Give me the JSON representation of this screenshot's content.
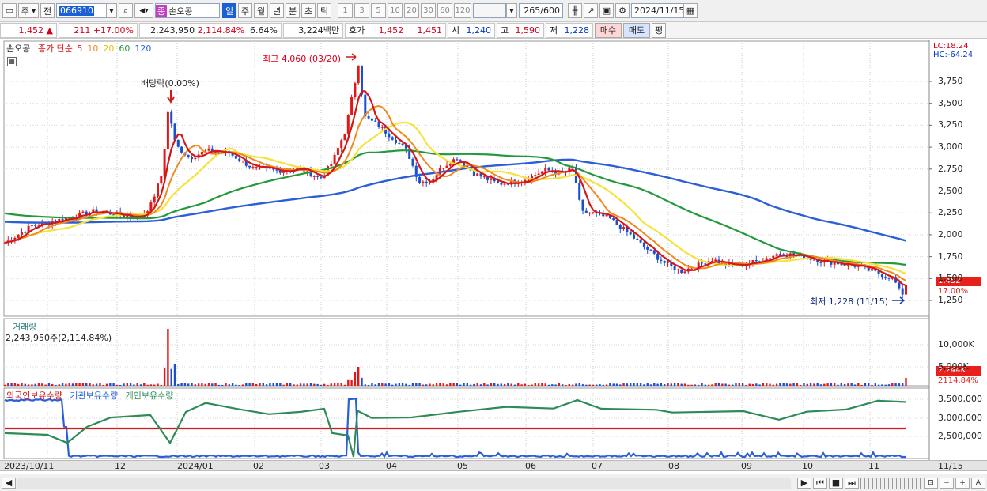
{
  "toolbar": {
    "period_week": "주",
    "period_prev": "전",
    "code": "066910",
    "stock_name": "손오공",
    "stock_badge": "종",
    "periods": [
      "일",
      "주",
      "월",
      "년",
      "분",
      "초",
      "틱"
    ],
    "intervals": [
      "1",
      "3",
      "5",
      "10",
      "20",
      "30",
      "60",
      "120"
    ],
    "count": "265",
    "count_max": "/600",
    "date": "2024/11/15"
  },
  "info": {
    "price": "1,452",
    "arrow": "▲",
    "change": "211",
    "change_pct": "+17.00%",
    "volume": "2,243,950",
    "volume_pct": "2,114.84%",
    "turnover_pct": "6.64%",
    "amount": "3,224백만",
    "quote_label": "호가",
    "ask": "1,452",
    "bid": "1,451",
    "open_label": "시",
    "open": "1,240",
    "high_label": "고",
    "high": "1,590",
    "low_label": "저",
    "low": "1,228",
    "buy": "매수",
    "sell": "매도",
    "avg": "평"
  },
  "price_panel": {
    "stock": "손오공",
    "ma_label": "종가 단순",
    "ma": [
      "5",
      "10",
      "20",
      "60",
      "120"
    ],
    "ma_colors": [
      "#d21818",
      "#f08a1e",
      "#f5e23a",
      "#239a3a",
      "#2a5fd8"
    ],
    "lc": "LC:18.24",
    "hc": "HC:-64.24",
    "high_note": "최고 4,060 (03/20)",
    "low_note": "최저 1,228 (11/15)",
    "dividend_note": "배당락(0.00%)",
    "last_price": "1,452",
    "last_pct": "17.00%",
    "y_ticks": [
      "3,750",
      "3,500",
      "3,250",
      "3,000",
      "2,750",
      "2,500",
      "2,250",
      "2,000",
      "1,750",
      "1,500",
      "1,250"
    ]
  },
  "volume_panel": {
    "title": "거래량",
    "value": "2,243,950주(2,114.84%)",
    "y_ticks": [
      "10,000K",
      "5,000K"
    ],
    "last": "2,244K",
    "last_pct": "2114.84%"
  },
  "holding_panel": {
    "series": [
      "외국인보유수량",
      "기관보유수량",
      "개인보유수량"
    ],
    "colors": [
      "#2a5fd8",
      "#d21818",
      "#2e8b57"
    ],
    "y_ticks": [
      "3,500,000",
      "3,000,000",
      "2,500,000"
    ]
  },
  "x_labels": [
    "2023/10/11",
    "12",
    "2024/01",
    "02",
    "03",
    "04",
    "05",
    "06",
    "07",
    "08",
    "09",
    "10",
    "11",
    "11/15"
  ]
}
